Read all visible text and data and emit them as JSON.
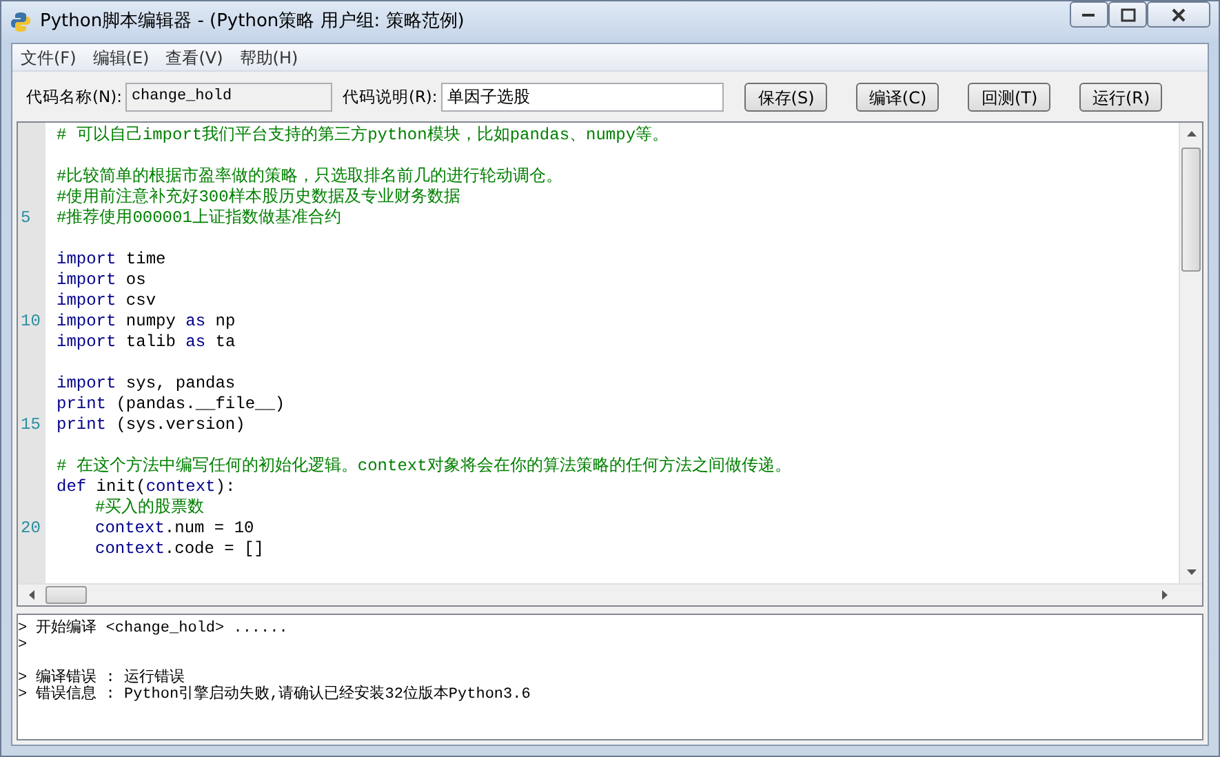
{
  "window": {
    "title": "Python脚本编辑器 - (Python策略 用户组: 策略范例)"
  },
  "menu": [
    "文件(F)",
    "编辑(E)",
    "查看(V)",
    "帮助(H)"
  ],
  "toolbar": {
    "name_label": "代码名称(N):",
    "name_value": "change_hold",
    "desc_label": "代码说明(R):",
    "desc_value": "单因子选股",
    "buttons": [
      "保存(S)",
      "编译(C)",
      "回测(T)",
      "运行(R)"
    ]
  },
  "editor": {
    "lines": [
      {
        "kind": "code",
        "tokens": [
          {
            "kind": "comment",
            "text": "# 可以自己import我们平台支持的第三方python模块，比如pandas、numpy等。"
          }
        ]
      },
      {
        "kind": "blank"
      },
      {
        "kind": "code",
        "tokens": [
          {
            "kind": "comment",
            "text": "#比较简单的根据市盈率做的策略，只选取排名前几的进行轮动调仓。"
          }
        ]
      },
      {
        "kind": "code",
        "tokens": [
          {
            "kind": "comment",
            "text": "#使用前注意补充好300样本股历史数据及专业财务数据"
          }
        ]
      },
      {
        "kind": "code",
        "number": "5",
        "tokens": [
          {
            "kind": "comment",
            "text": "#推荐使用000001上证指数做基准合约"
          }
        ]
      },
      {
        "kind": "blank"
      },
      {
        "kind": "code",
        "tokens": [
          {
            "kind": "keyword",
            "text": "import"
          },
          {
            "kind": "plain",
            "text": " time"
          }
        ]
      },
      {
        "kind": "code",
        "tokens": [
          {
            "kind": "keyword",
            "text": "import"
          },
          {
            "kind": "plain",
            "text": " os"
          }
        ]
      },
      {
        "kind": "code",
        "tokens": [
          {
            "kind": "keyword",
            "text": "import"
          },
          {
            "kind": "plain",
            "text": " csv"
          }
        ]
      },
      {
        "kind": "code",
        "number": "10",
        "tokens": [
          {
            "kind": "keyword",
            "text": "import"
          },
          {
            "kind": "plain",
            "text": " numpy "
          },
          {
            "kind": "keyword",
            "text": "as"
          },
          {
            "kind": "plain",
            "text": " np"
          }
        ]
      },
      {
        "kind": "code",
        "tokens": [
          {
            "kind": "keyword",
            "text": "import"
          },
          {
            "kind": "plain",
            "text": " talib "
          },
          {
            "kind": "keyword",
            "text": "as"
          },
          {
            "kind": "plain",
            "text": " ta"
          }
        ]
      },
      {
        "kind": "blank"
      },
      {
        "kind": "code",
        "tokens": [
          {
            "kind": "keyword",
            "text": "import"
          },
          {
            "kind": "plain",
            "text": " sys, pandas"
          }
        ]
      },
      {
        "kind": "code",
        "tokens": [
          {
            "kind": "keyword",
            "text": "print"
          },
          {
            "kind": "plain",
            "text": " (pandas.__file__)"
          }
        ]
      },
      {
        "kind": "code",
        "number": "15",
        "tokens": [
          {
            "kind": "keyword",
            "text": "print"
          },
          {
            "kind": "plain",
            "text": " (sys.version)"
          }
        ]
      },
      {
        "kind": "blank"
      },
      {
        "kind": "code",
        "tokens": [
          {
            "kind": "comment",
            "text": "# 在这个方法中编写任何的初始化逻辑。context对象将会在你的算法策略的任何方法之间做传递。"
          }
        ]
      },
      {
        "kind": "code",
        "tokens": [
          {
            "kind": "keyword",
            "text": "def"
          },
          {
            "kind": "plain",
            "text": " init("
          },
          {
            "kind": "keyword",
            "text": "context"
          },
          {
            "kind": "plain",
            "text": "):"
          }
        ]
      },
      {
        "kind": "code",
        "indented": true,
        "tokens": [
          {
            "kind": "comment",
            "text": "#买入的股票数"
          }
        ]
      },
      {
        "kind": "code",
        "number": "20",
        "indented": true,
        "tokens": [
          {
            "kind": "keyword",
            "text": "context"
          },
          {
            "kind": "plain",
            "text": ".num = 10"
          }
        ]
      },
      {
        "kind": "code",
        "indented": true,
        "tokens": [
          {
            "kind": "keyword",
            "text": "context"
          },
          {
            "kind": "plain",
            "text": ".code = []"
          }
        ]
      },
      {
        "kind": "blank"
      }
    ]
  },
  "output": {
    "lines": [
      {
        "kind": "message",
        "text": "> 开始编译 <change_hold> ......"
      },
      {
        "kind": "message",
        "text": ">"
      },
      {
        "kind": "blank"
      },
      {
        "kind": "message",
        "text": "> 编译错误 : 运行错误"
      },
      {
        "kind": "message",
        "text": "> 错误信息 : Python引擎启动失败,请确认已经安装32位版本Python3.6"
      }
    ]
  }
}
